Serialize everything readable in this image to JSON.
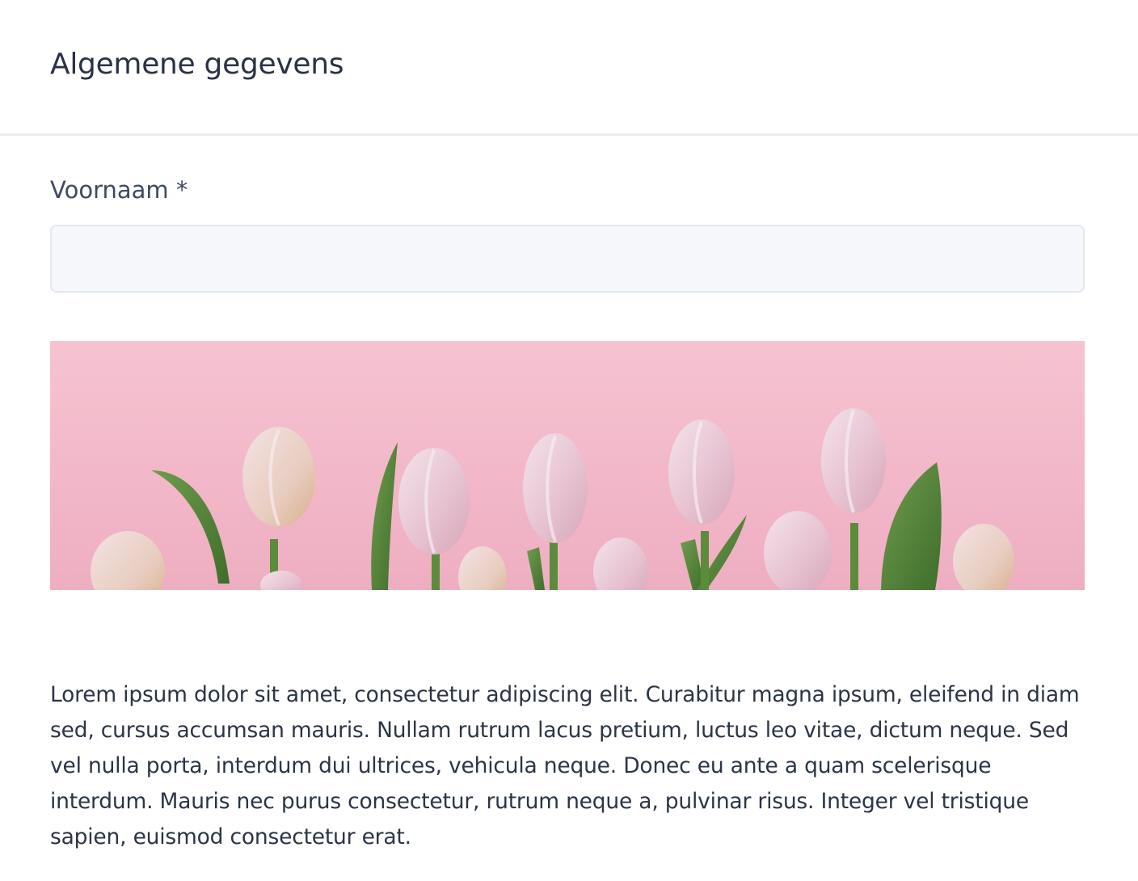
{
  "section": {
    "title": "Algemene gegevens"
  },
  "form": {
    "first_name": {
      "label": "Voornaam *",
      "value": "",
      "placeholder": ""
    }
  },
  "banner": {
    "image_subject": "pink tulips on pink background",
    "background_color": "#f2b8c8"
  },
  "content": {
    "paragraph": "Lorem ipsum dolor sit amet, consectetur adipiscing elit. Curabitur magna ipsum, eleifend in diam sed, cursus accumsan mauris. Nullam rutrum lacus pretium, luctus leo vitae, dictum neque. Sed vel nulla porta, interdum dui ultrices, vehicula neque. Donec eu ante a quam scelerisque interdum. Mauris nec purus consectetur, rutrum neque a, pulvinar risus. Integer vel tristique sapien, euismod consectetur erat."
  }
}
